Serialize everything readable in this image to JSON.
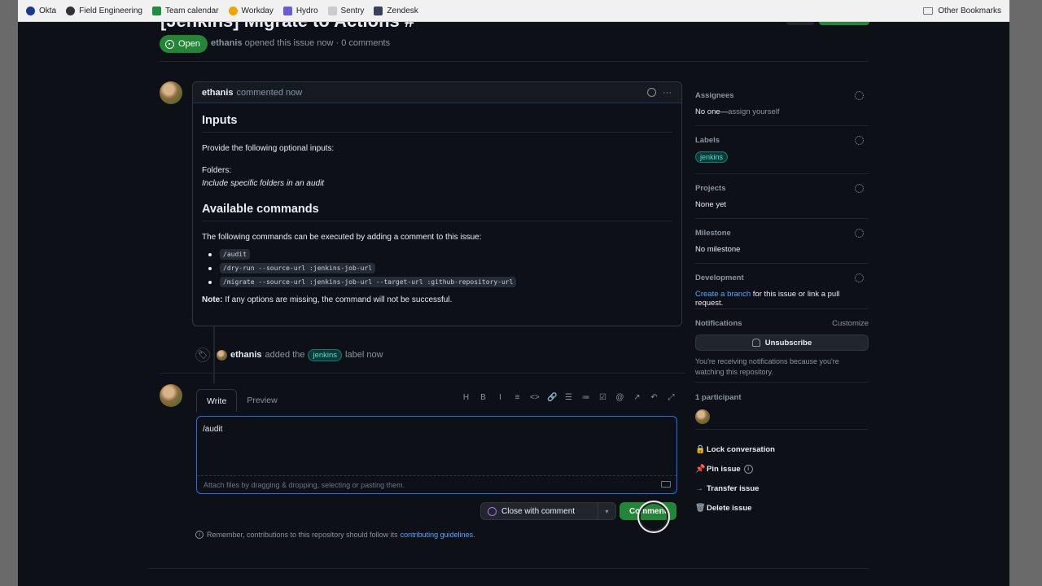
{
  "bookmarks": {
    "items": [
      {
        "label": "Okta",
        "color": "#1c3a8a"
      },
      {
        "label": "Field Engineering",
        "color": "#333333"
      },
      {
        "label": "Team calendar",
        "color": "#1e8e3e"
      },
      {
        "label": "Workday",
        "color": "#f0a500"
      },
      {
        "label": "Hydro",
        "color": "#6b5bd6"
      },
      {
        "label": "Sentry",
        "color": "#cccccc"
      },
      {
        "label": "Zendesk",
        "color": "#3a3f5a"
      }
    ],
    "other": "Other Bookmarks"
  },
  "issue": {
    "title_fragment": "[Jenkins] Migrate to Actions #",
    "state": "Open",
    "author": "ethanis",
    "meta_rest": "opened this issue now · 0 comments"
  },
  "comment": {
    "author": "ethanis",
    "time": "commented now",
    "heading_inputs": "Inputs",
    "provide_text": "Provide the following optional inputs:",
    "folders_label": "Folders:",
    "folders_desc": "Include specific folders in an audit",
    "heading_commands": "Available commands",
    "commands_intro": "The following commands can be executed by adding a comment to this issue:",
    "commands": [
      "/audit",
      "/dry-run --source-url :jenkins-job-url",
      "/migrate --source-url :jenkins-job-url --target-url :github-repository-url"
    ],
    "note_label": "Note:",
    "note_text": "If any options are missing, the command will not be successful."
  },
  "event": {
    "actor": "ethanis",
    "action": "added the",
    "label": "jenkins",
    "suffix": "label now"
  },
  "editor": {
    "tab_write": "Write",
    "tab_preview": "Preview",
    "toolbar": [
      "H",
      "B",
      "I",
      "≡",
      "<>",
      "🔗",
      "☰",
      "≔",
      "☑",
      "@",
      "↗",
      "↶",
      "⤢"
    ],
    "text": "/audit",
    "attach_hint": "Attach files by dragging & dropping, selecting or pasting them.",
    "close_label": "Close with comment",
    "comment_label": "Comment",
    "note_text": "Remember, contributions to this repository should follow its",
    "note_link": "contributing guidelines",
    "note_end": "."
  },
  "sidebar": {
    "assignees_title": "Assignees",
    "assignees_value": "No one—",
    "assignees_link": "assign yourself",
    "labels_title": "Labels",
    "label": "jenkins",
    "projects_title": "Projects",
    "projects_value": "None yet",
    "milestone_title": "Milestone",
    "milestone_value": "No milestone",
    "development_title": "Development",
    "development_link": "Create a branch",
    "development_rest": "for this issue or link a pull request.",
    "notifications_title": "Notifications",
    "customize": "Customize",
    "unsubscribe": "Unsubscribe",
    "notif_reason": "You're receiving notifications because you're watching this repository.",
    "participants": "1 participant",
    "actions": [
      {
        "icon": "lock-icon",
        "glyph": "🔒",
        "label": "Lock conversation"
      },
      {
        "icon": "pin-icon",
        "glyph": "📌",
        "label": "Pin issue"
      },
      {
        "icon": "arrow-right-icon",
        "glyph": "→",
        "label": "Transfer issue"
      },
      {
        "icon": "trash-icon",
        "glyph": "🗑",
        "label": "Delete issue"
      }
    ]
  }
}
